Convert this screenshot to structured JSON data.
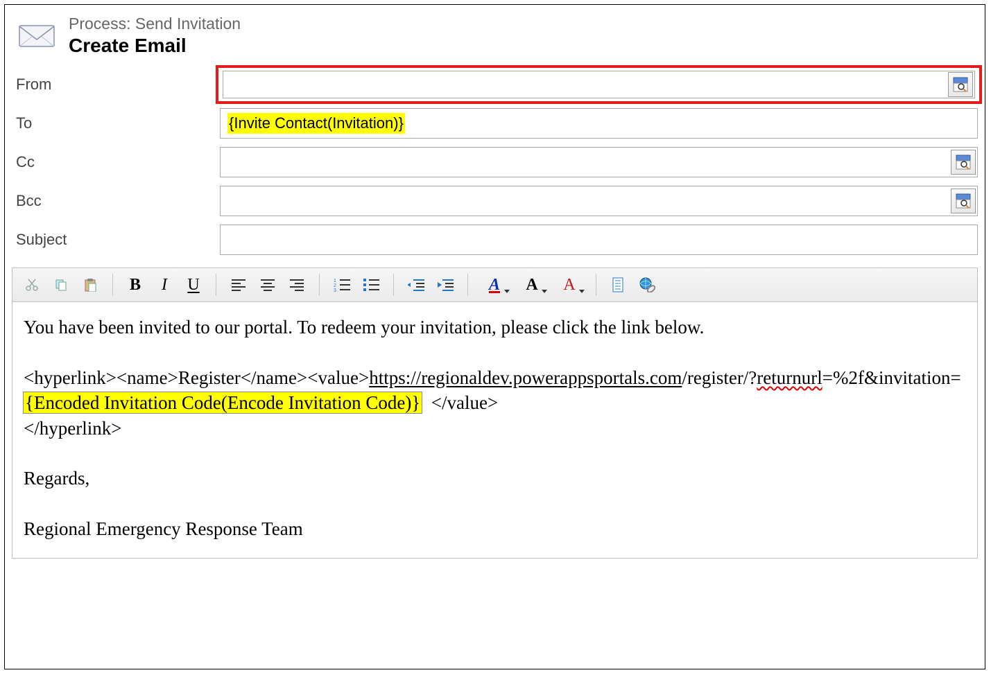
{
  "header": {
    "process_label": "Process: Send Invitation",
    "title": "Create Email"
  },
  "fields": {
    "from": {
      "label": "From",
      "value": ""
    },
    "to": {
      "label": "To",
      "value": "{Invite Contact(Invitation)}"
    },
    "cc": {
      "label": "Cc",
      "value": ""
    },
    "bcc": {
      "label": "Bcc",
      "value": ""
    },
    "subject": {
      "label": "Subject",
      "value": ""
    }
  },
  "toolbar_icons": {
    "cut": "cut-icon",
    "copy": "copy-icon",
    "paste": "paste-icon",
    "bold": "B",
    "italic": "I",
    "underline": "U",
    "align_left": "align-left",
    "align_center": "align-center",
    "align_right": "align-right",
    "ol": "ordered-list",
    "ul": "unordered-list",
    "outdent": "outdent",
    "indent": "indent",
    "style": "A",
    "size": "A",
    "color": "A",
    "doc": "document-icon",
    "web": "hyperlink-icon"
  },
  "body": {
    "line1": "You have been invited to our portal. To redeem your invitation, please click the link below.",
    "hyper_open": "<hyperlink><name>Register</name><value>",
    "url_part1": "https://regionaldev.powerappsportals.com",
    "url_part2": "/register/?",
    "url_part3": "returnurl",
    "url_part4": "=%2f&invitation=",
    "highlight": "{Encoded Invitation Code(Encode Invitation Code)}",
    "hyper_close_value": "</value>",
    "hyper_close": "</hyperlink>",
    "regards": "Regards,",
    "signature": "Regional Emergency Response Team"
  },
  "colors": {
    "highlight_red": "#e21b1b",
    "highlight_yellow": "#ffff00"
  }
}
